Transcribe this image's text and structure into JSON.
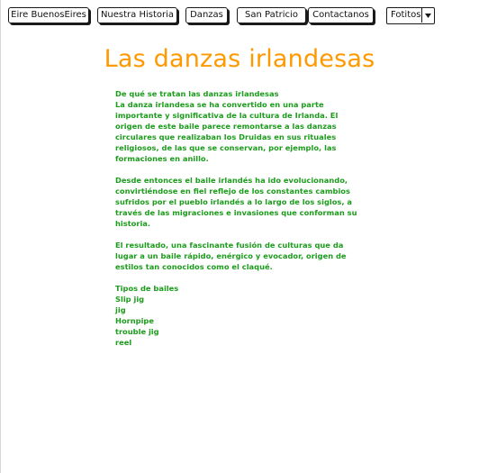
{
  "nav": {
    "items": [
      {
        "label": "Eire BuenosEires"
      },
      {
        "label": "Nuestra Historia"
      },
      {
        "label": "Danzas"
      },
      {
        "label": "San Patricio"
      },
      {
        "label": "Contactanos"
      }
    ],
    "dropdown": {
      "selected": "Fotitos",
      "icon": "chevron-down-icon"
    }
  },
  "page": {
    "title": "Las danzas irlandesas"
  },
  "content": {
    "heading": "De qué se tratan las danzas irlandesas",
    "para1": [
      "La danza irlandesa se ha convertido en una parte",
      "importante y significativa de la cultura de Irlanda. El",
      "origen de este baile parece remontarse a las danzas",
      "circulares que realizaban los Druidas en sus rituales",
      "religiosos, de las que se conservan, por ejemplo, las",
      "formaciones en anillo."
    ],
    "para2": [
      "Desde entonces el baile irlandés ha ido evolucionando,",
      "convirtiéndose en fiel reflejo de los constantes cambios",
      "sufridos por el pueblo irlandés a lo largo de los siglos, a",
      "través de las migraciones e invasiones que conforman su",
      "historia."
    ],
    "para3": [
      "El resultado, una fascinante fusión de culturas que da",
      "lugar a un baile rápido, enérgico y evocador, origen de",
      "estilos tan conocidos como el claqué."
    ],
    "types_heading": "Tipos de bailes",
    "types": [
      "Slip jig",
      "jig",
      "Hornpipe",
      "trouble jig",
      "reel"
    ]
  },
  "colors": {
    "title": "#ff9900",
    "body_text": "#1c9c1c",
    "button_border": "#1a1a1a"
  }
}
